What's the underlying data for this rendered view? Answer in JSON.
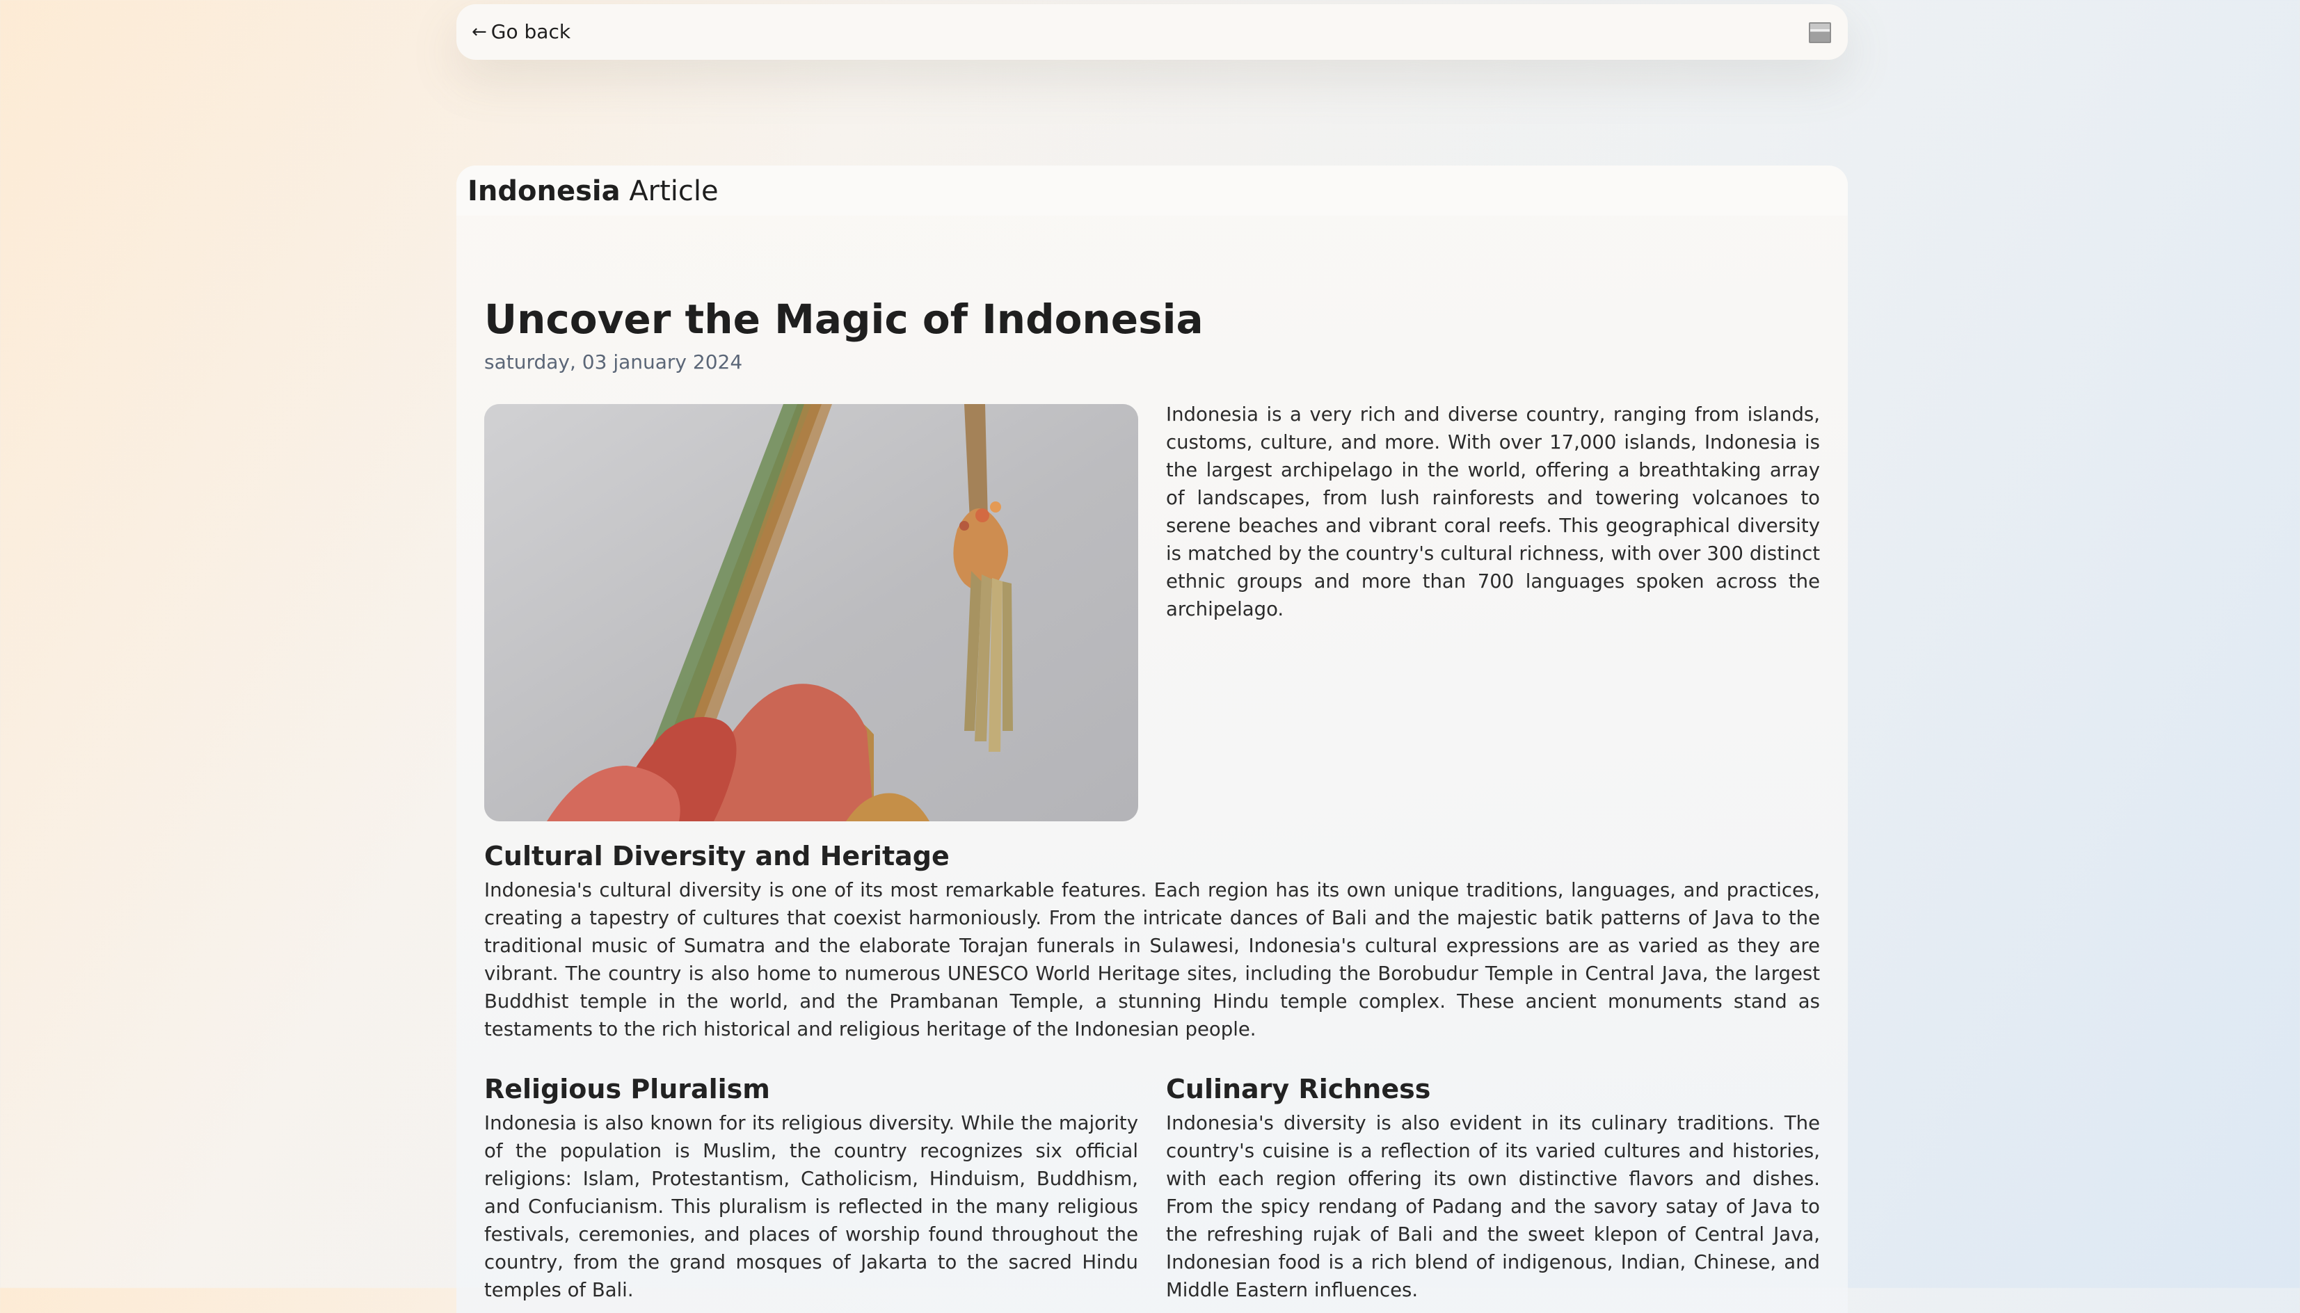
{
  "topbar": {
    "back_label": "Go back",
    "back_icon": "left-arrow-icon",
    "corner_icon": "image-thumbnail-icon"
  },
  "panel": {
    "title_strong": "Indonesia",
    "title_light": "Article"
  },
  "article": {
    "title": "Uncover the Magic of Indonesia",
    "date": "saturday, 03 january 2024",
    "intro": "Indonesia is a very rich and diverse country, ranging from islands, customs, culture, and more. With over 17,000 islands, Indonesia is the largest archipelago in the world, offering a breathtaking array of landscapes, from lush rainforests and towering volcanoes to serene beaches and vibrant coral reefs. This geographical diversity is matched by the country's cultural richness, with over 300 distinct ethnic groups and more than 700 languages spoken across the archipelago.",
    "sections": {
      "cultural": {
        "title": "Cultural Diversity and Heritage",
        "text": "Indonesia's cultural diversity is one of its most remarkable features. Each region has its own unique traditions, languages, and practices, creating a tapestry of cultures that coexist harmoniously. From the intricate dances of Bali and the majestic batik patterns of Java to the traditional music of Sumatra and the elaborate Torajan funerals in Sulawesi, Indonesia's cultural expressions are as varied as they are vibrant. The country is also home to numerous UNESCO World Heritage sites, including the Borobudur Temple in Central Java, the largest Buddhist temple in the world, and the Prambanan Temple, a stunning Hindu temple complex. These ancient monuments stand as testaments to the rich historical and religious heritage of the Indonesian people."
      },
      "religion": {
        "title": "Religious Pluralism",
        "text": "Indonesia is also known for its religious diversity. While the majority of the population is Muslim, the country recognizes six official religions: Islam, Protestantism, Catholicism, Hinduism, Buddhism, and Confucianism. This pluralism is reflected in the many religious festivals, ceremonies, and places of worship found throughout the country, from the grand mosques of Jakarta to the sacred Hindu temples of Bali."
      },
      "culinary": {
        "title": "Culinary Richness",
        "text": "Indonesia's diversity is also evident in its culinary traditions. The country's cuisine is a reflection of its varied cultures and histories, with each region offering its own distinctive flavors and dishes. From the spicy rendang of Padang and the savory satay of Java to the refreshing rujak of Bali and the sweet klepon of Central Java, Indonesian food is a rich blend of indigenous, Indian, Chinese, and Middle Eastern influences."
      }
    }
  }
}
